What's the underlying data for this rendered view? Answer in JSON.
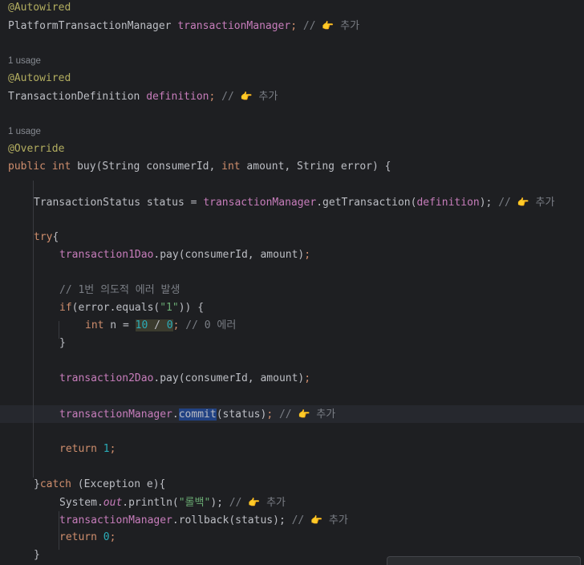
{
  "block1": {
    "annotation": "@Autowired",
    "type": "PlatformTransactionManager",
    "field": "transactionManager",
    "semicolon": ";",
    "comment_slashes": "//",
    "comment_icon": "👉",
    "comment_text": "추가"
  },
  "block2": {
    "usage": "1 usage",
    "annotation": "@Autowired",
    "type": "TransactionDefinition",
    "field": "definition",
    "semicolon": ";",
    "comment_slashes": "//",
    "comment_icon": "👉",
    "comment_text": "추가"
  },
  "method": {
    "usage": "1 usage",
    "annotation": "@Override",
    "kw_public": "public",
    "kw_int": "int",
    "name_and_params_1": " buy(String consumerId, ",
    "kw_int2": "int",
    "params_2": " amount, String error) {"
  },
  "status_line": {
    "type": "TransactionStatus status = ",
    "field": "transactionManager",
    "call": ".getTransaction(",
    "arg": "definition",
    "end": ");",
    "comment_slashes": "//",
    "comment_icon": "👉",
    "comment_text": "추가"
  },
  "try_block": {
    "kw_try": "try",
    "brace": "{",
    "dao1_field": "transaction1Dao",
    "dao1_call": ".pay(consumerId, amount)",
    "semicolon": ";",
    "comment_error": "// 1번 의도적 에러 발생",
    "if_kw": "if",
    "if_cond_1": "(error.equals(",
    "if_str": "\"1\"",
    "if_cond_2": ")) {",
    "int_kw": "int",
    "n_assign": " n = ",
    "num10": "10",
    "div": " / ",
    "num0": "0",
    "int_semicolon": ";",
    "int_comment": "// 0 에러",
    "close_if": "}",
    "dao2_field": "transaction2Dao",
    "dao2_call": ".pay(consumerId, amount)",
    "tm_field": "transactionManager",
    "dot": ".",
    "commit": "commit",
    "commit_args": "(status)",
    "commit_comment_slashes": "//",
    "commit_comment_icon": "👉",
    "commit_comment_text": "추가",
    "return_kw": "return",
    "return_val": "1",
    "return_semi": ";"
  },
  "catch_block": {
    "close_try": "}",
    "catch_kw": "catch",
    "catch_rest": " (Exception e){",
    "system": "System.",
    "out": "out",
    "println": ".println(",
    "str": "\"롤백\"",
    "println_end": ");",
    "comment_slashes": "//",
    "comment_icon": "👉",
    "comment_text": "추가",
    "tm_field": "transactionManager",
    "rollback": ".rollback(status);",
    "rollback_comment_slashes": "//",
    "rollback_comment_icon": "👉",
    "rollback_comment_text": "추가",
    "return_kw": "return",
    "return_val": "0",
    "return_semi": ";",
    "close_catch": "}"
  }
}
